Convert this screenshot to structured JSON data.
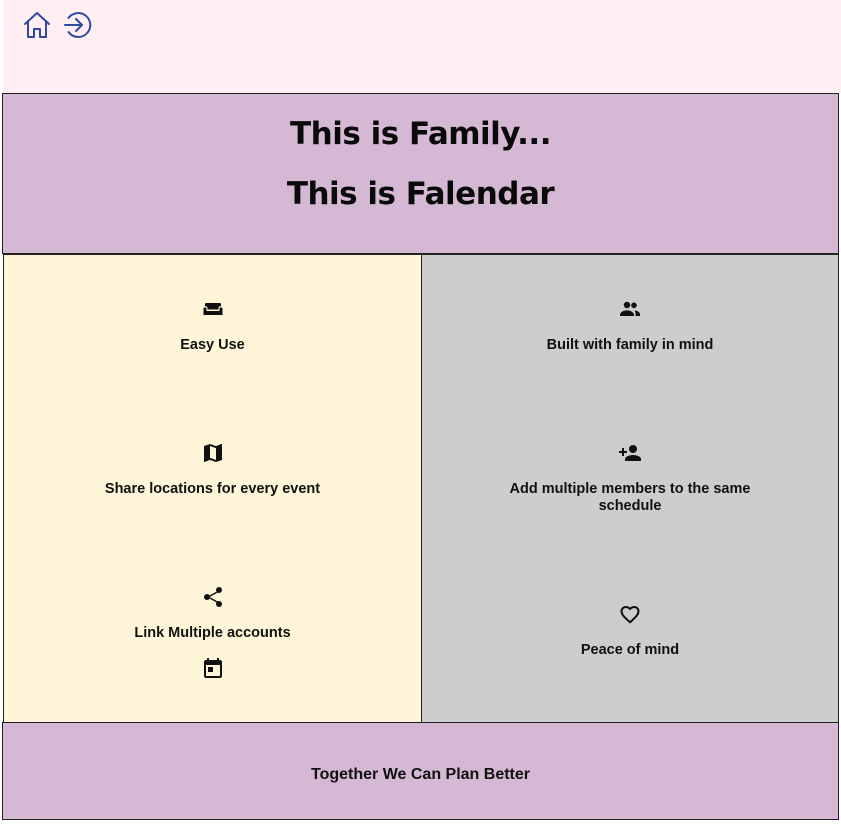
{
  "nav": {
    "home_icon": "home-icon",
    "login_icon": "login-icon",
    "icon_color": "#2f4aa0"
  },
  "hero": {
    "title_line1": "This is Family...",
    "title_line2": "This is Falendar",
    "background": "#d5b8d3"
  },
  "features_left": {
    "background": "#fff5d9",
    "items": [
      {
        "icon": "couch-icon",
        "label": "Easy Use"
      },
      {
        "icon": "map-icon",
        "label": "Share locations for every event"
      },
      {
        "icon": "share-icon",
        "label": "Link Multiple accounts"
      }
    ],
    "extra_icon": "calendar-icon"
  },
  "features_right": {
    "background": "#cdcdcd",
    "items": [
      {
        "icon": "group-icon",
        "label": "Built with family in mind"
      },
      {
        "icon": "person-add-icon",
        "label": "Add multiple members to the same schedule"
      },
      {
        "icon": "heart-icon",
        "label": "Peace of mind"
      }
    ]
  },
  "footer": {
    "tagline": "Together We Can Plan Better"
  }
}
